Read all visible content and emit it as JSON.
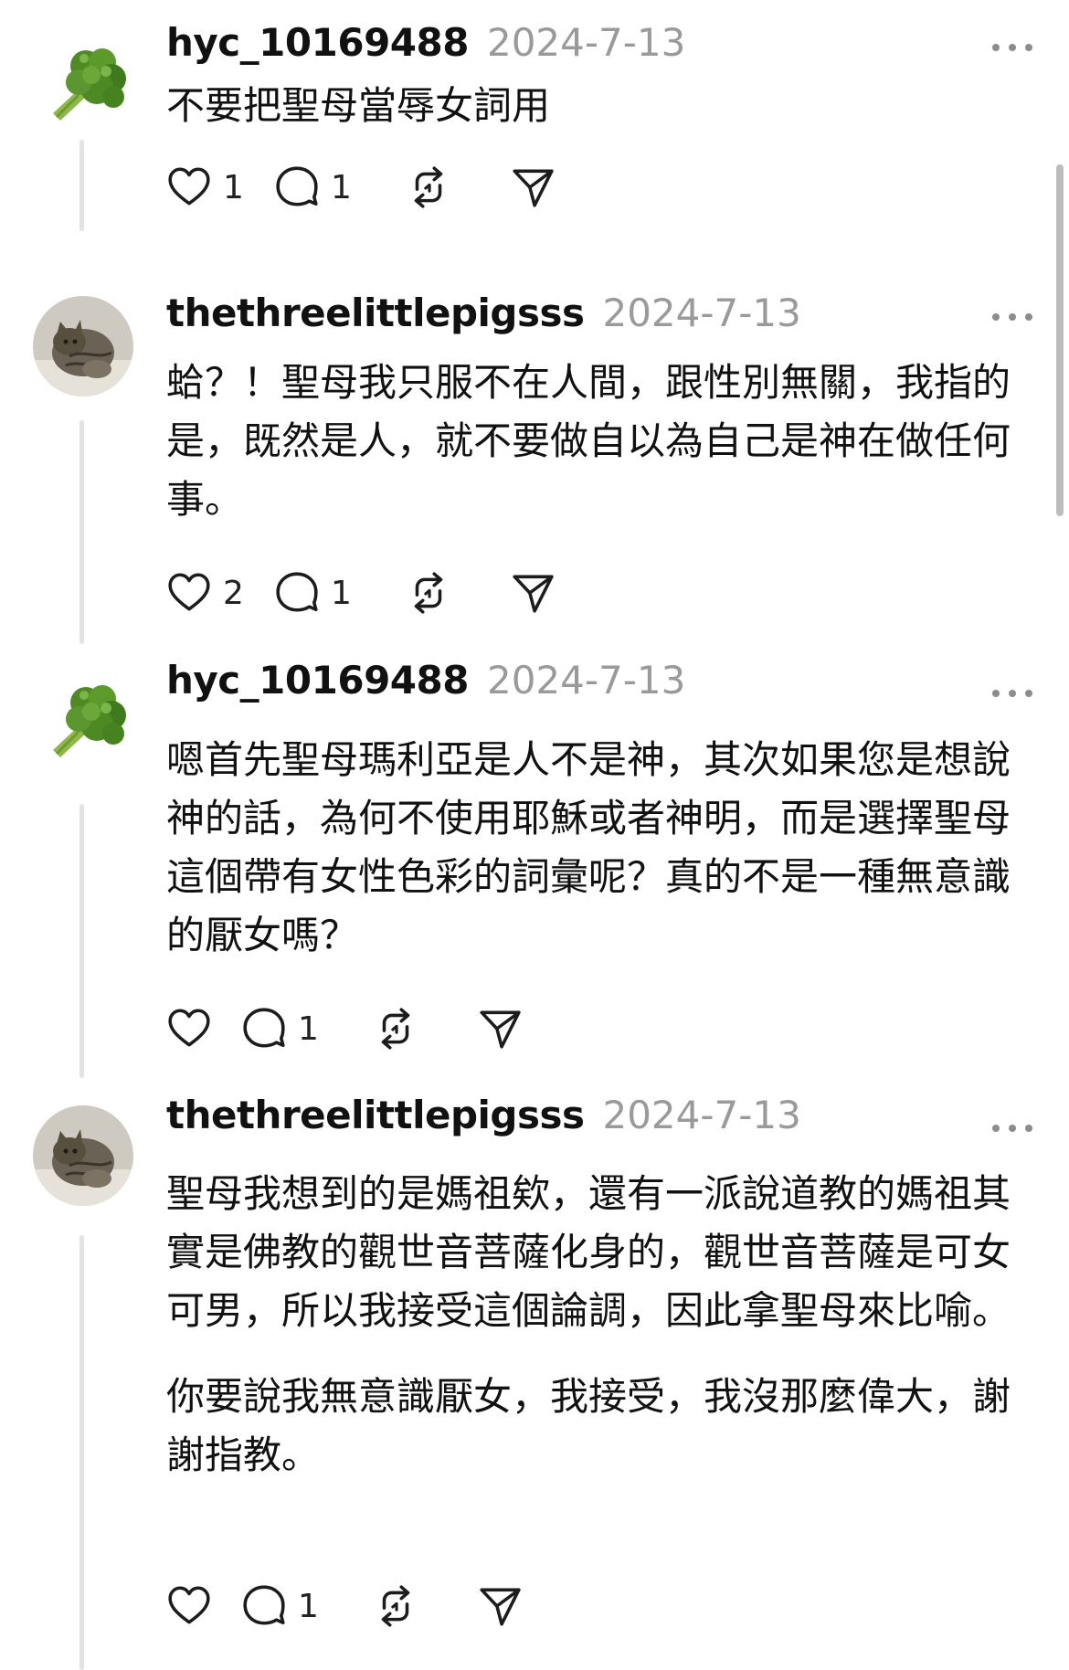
{
  "colors": {
    "text": "#111111",
    "muted": "#9a9a9a",
    "thread_line": "#e3e3e3",
    "icon": "#1c1c1c"
  },
  "posts": [
    {
      "username": "hyc_10169488",
      "date": "2024-7-13",
      "avatar_icon": "broccoli-avatar",
      "paragraphs": [
        "不要把聖母當辱女詞用"
      ],
      "actions": {
        "likes": "1",
        "replies": "1"
      }
    },
    {
      "username": "thethreelittlepigsss",
      "date": "2024-7-13",
      "avatar_icon": "cat-avatar",
      "paragraphs": [
        "蛤？！聖母我只服不在人間，跟性別無關，我指的是，既然是人，就不要做自以為自己是神在做任何事。"
      ],
      "actions": {
        "likes": "2",
        "replies": "1"
      }
    },
    {
      "username": "hyc_10169488",
      "date": "2024-7-13",
      "avatar_icon": "broccoli-avatar",
      "paragraphs": [
        "嗯首先聖母瑪利亞是人不是神，其次如果您是想說神的話，為何不使用耶穌或者神明，而是選擇聖母這個帶有女性色彩的詞彙呢？真的不是一種無意識的厭女嗎？"
      ],
      "actions": {
        "likes": "",
        "replies": "1"
      }
    },
    {
      "username": "thethreelittlepigsss",
      "date": "2024-7-13",
      "avatar_icon": "cat-avatar",
      "paragraphs": [
        "聖母我想到的是媽祖欸，還有一派說道教的媽祖其實是佛教的觀世音菩薩化身的，觀世音菩薩是可女可男，所以我接受這個論調，因此拿聖母來比喻。",
        "你要說我無意識厭女，我接受，我沒那麼偉大，謝謝指教。"
      ],
      "actions": {
        "likes": "",
        "replies": "1"
      }
    }
  ]
}
